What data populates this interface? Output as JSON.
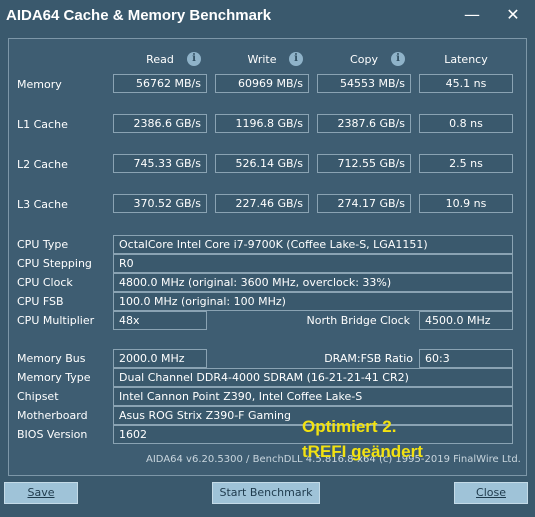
{
  "window": {
    "title": "AIDA64 Cache & Memory Benchmark",
    "minimize": "—",
    "close": "✕"
  },
  "columns": {
    "read": "Read",
    "write": "Write",
    "copy": "Copy",
    "latency": "Latency"
  },
  "bench": {
    "memory": {
      "label": "Memory",
      "read": "56762 MB/s",
      "write": "60969 MB/s",
      "copy": "54553 MB/s",
      "latency": "45.1 ns"
    },
    "l1": {
      "label": "L1 Cache",
      "read": "2386.6 GB/s",
      "write": "1196.8 GB/s",
      "copy": "2387.6 GB/s",
      "latency": "0.8 ns"
    },
    "l2": {
      "label": "L2 Cache",
      "read": "745.33 GB/s",
      "write": "526.14 GB/s",
      "copy": "712.55 GB/s",
      "latency": "2.5 ns"
    },
    "l3": {
      "label": "L3 Cache",
      "read": "370.52 GB/s",
      "write": "227.46 GB/s",
      "copy": "274.17 GB/s",
      "latency": "10.9 ns"
    }
  },
  "cpu": {
    "type_label": "CPU Type",
    "type": "OctalCore Intel Core i7-9700K  (Coffee Lake-S, LGA1151)",
    "stepping_label": "CPU Stepping",
    "stepping": "R0",
    "clock_label": "CPU Clock",
    "clock": "4800.0 MHz  (original: 3600 MHz, overclock: 33%)",
    "fsb_label": "CPU FSB",
    "fsb": "100.0 MHz  (original: 100 MHz)",
    "multiplier_label": "CPU Multiplier",
    "multiplier": "48x",
    "nb_clock_label": "North Bridge Clock",
    "nb_clock": "4500.0 MHz"
  },
  "system": {
    "membus_label": "Memory Bus",
    "membus": "2000.0 MHz",
    "dram_ratio_label": "DRAM:FSB Ratio",
    "dram_ratio": "60:3",
    "memtype_label": "Memory Type",
    "memtype": "Dual Channel DDR4-4000 SDRAM  (16-21-21-41 CR2)",
    "chipset_label": "Chipset",
    "chipset": "Intel Cannon Point Z390, Intel Coffee Lake-S",
    "motherboard_label": "Motherboard",
    "motherboard": "Asus ROG Strix Z390-F Gaming",
    "bios_label": "BIOS Version",
    "bios": "1602"
  },
  "footer": {
    "version": "AIDA64 v6.20.5300 / BenchDLL 4.5.816.8-x64  (c) 1995-2019 FinalWire Ltd.",
    "overlay_line1": "Optimiert 2.",
    "overlay_line2": "tREFI geändert"
  },
  "buttons": {
    "save": "Save",
    "start": "Start Benchmark",
    "close": "Close"
  },
  "colors": {
    "background": "#3a596d",
    "button": "#9fc3d8",
    "overlay_text": "#f2e210"
  }
}
